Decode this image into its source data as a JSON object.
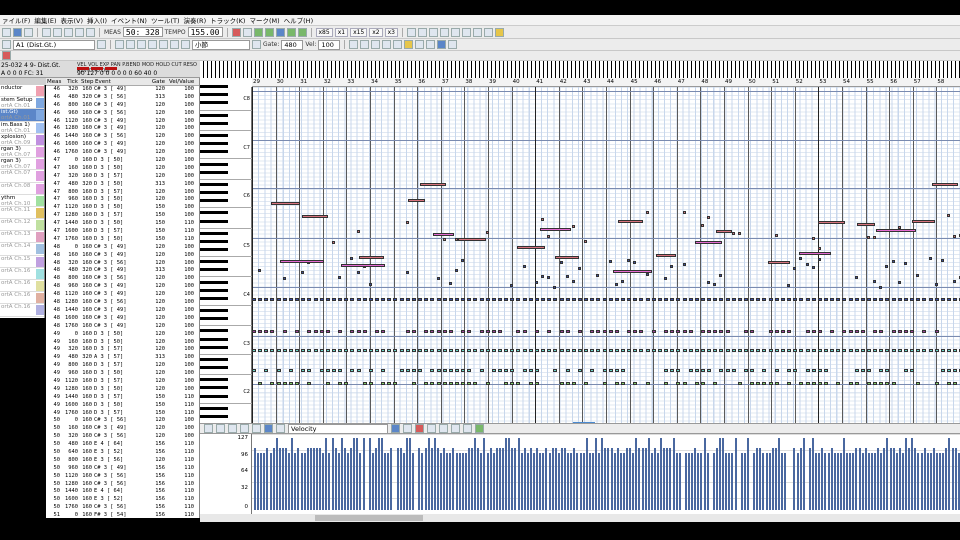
{
  "menu": [
    "ァイル(F)",
    "編集(E)",
    "表示(V)",
    "挿入(I)",
    "イベント(N)",
    "ツール(T)",
    "演奏(R)",
    "トラック(K)",
    "マーク(M)",
    "ヘルプ(H)"
  ],
  "transport": {
    "meas_label": "MEAS",
    "position": "50: 328",
    "tempo_label": "TEMPO",
    "tempo": "155.00",
    "speeds": [
      "x85",
      "x1",
      "x15",
      "x2",
      "x3"
    ]
  },
  "toolbar2": {
    "track_select": "A1 (Dist.Gt.)",
    "measure_select": "小節",
    "gate_label": "Gate:",
    "gate_value": "480",
    "vel_label": "Vel:",
    "vel_value": "100"
  },
  "trackinfo": {
    "line1": "25-032 4 9- Dist.Gt.",
    "line2": "A 0 0 0 FC: 31",
    "meter_labels": "VEL VOL EXP PAN P.BEND MOD HOLD CUT RESO REV CHO DLY",
    "meter_values": "90 127 0 0 0 0 0 0 60 40 0"
  },
  "tracks": [
    {
      "name": "nductor",
      "port": ""
    },
    {
      "name": "stem Setup",
      "port": "ortA Ch.01"
    },
    {
      "name": "ist.Gt)",
      "port": "ortA Ch.01"
    },
    {
      "name": "im.Bass 1)",
      "port": "ortA Ch.01"
    },
    {
      "name": "xplosion)",
      "port": "ortA Ch.09"
    },
    {
      "name": "rgan 3)",
      "port": "ortA Ch.07"
    },
    {
      "name": "rgan 3)",
      "port": "ortA Ch.07"
    },
    {
      "name": "",
      "port": "ortA Ch.07"
    },
    {
      "name": "",
      "port": "ortA Ch.08"
    },
    {
      "name": "ythm",
      "port": "ortA Ch.10"
    },
    {
      "name": "",
      "port": "ortA Ch.11"
    },
    {
      "name": "",
      "port": "ortA Ch.12"
    },
    {
      "name": "",
      "port": "ortA Ch.13"
    },
    {
      "name": "",
      "port": "ortA Ch.14"
    },
    {
      "name": "",
      "port": "ortA Ch.15"
    },
    {
      "name": "",
      "port": "ortA Ch.16"
    },
    {
      "name": "",
      "port": "ortA Ch.16"
    },
    {
      "name": "",
      "port": "ortA Ch.16"
    },
    {
      "name": "",
      "port": "ortA Ch.16"
    }
  ],
  "event_headers": [
    "Meas",
    "Tick",
    "Step",
    "Event",
    "Gate",
    "Vel/Value"
  ],
  "events": [
    [
      "46",
      "320",
      "160",
      "C# 3 [ 49]",
      "120",
      "100"
    ],
    [
      "46",
      "480",
      "320",
      "C# 3 [ 56]",
      "313",
      "100"
    ],
    [
      "46",
      "800",
      "160",
      "C# 3 [ 49]",
      "120",
      "100"
    ],
    [
      "46",
      "960",
      "160",
      "C# 3 [ 56]",
      "120",
      "100"
    ],
    [
      "46",
      "1120",
      "160",
      "C# 3 [ 49]",
      "120",
      "100"
    ],
    [
      "46",
      "1280",
      "160",
      "C# 3 [ 49]",
      "120",
      "100"
    ],
    [
      "46",
      "1440",
      "160",
      "C# 3 [ 56]",
      "120",
      "100"
    ],
    [
      "46",
      "1600",
      "160",
      "C# 3 [ 49]",
      "120",
      "100"
    ],
    [
      "46",
      "1760",
      "160",
      "C# 3 [ 49]",
      "120",
      "100"
    ],
    [
      "47",
      "0",
      "160",
      "D  3 [ 50]",
      "120",
      "100"
    ],
    [
      "47",
      "160",
      "160",
      "D  3 [ 50]",
      "120",
      "100"
    ],
    [
      "47",
      "320",
      "160",
      "D  3 [ 57]",
      "120",
      "100"
    ],
    [
      "47",
      "480",
      "320",
      "D  3 [ 50]",
      "313",
      "100"
    ],
    [
      "47",
      "800",
      "160",
      "D  3 [ 57]",
      "120",
      "100"
    ],
    [
      "47",
      "960",
      "160",
      "D  3 [ 50]",
      "120",
      "100"
    ],
    [
      "47",
      "1120",
      "160",
      "D  3 [ 50]",
      "150",
      "100"
    ],
    [
      "47",
      "1280",
      "160",
      "D  3 [ 57]",
      "150",
      "100"
    ],
    [
      "47",
      "1440",
      "160",
      "D  3 [ 50]",
      "150",
      "110"
    ],
    [
      "47",
      "1600",
      "160",
      "D  3 [ 57]",
      "150",
      "110"
    ],
    [
      "47",
      "1760",
      "160",
      "D  3 [ 50]",
      "150",
      "110"
    ],
    [
      "48",
      "0",
      "160",
      "C# 3 [ 49]",
      "120",
      "100"
    ],
    [
      "48",
      "160",
      "160",
      "C# 3 [ 49]",
      "120",
      "100"
    ],
    [
      "48",
      "320",
      "160",
      "C# 3 [ 56]",
      "120",
      "100"
    ],
    [
      "48",
      "480",
      "320",
      "C# 3 [ 49]",
      "313",
      "100"
    ],
    [
      "48",
      "800",
      "160",
      "C# 3 [ 56]",
      "120",
      "100"
    ],
    [
      "48",
      "960",
      "160",
      "C# 3 [ 49]",
      "120",
      "100"
    ],
    [
      "48",
      "1120",
      "160",
      "C# 3 [ 49]",
      "120",
      "100"
    ],
    [
      "48",
      "1280",
      "160",
      "C# 3 [ 56]",
      "120",
      "100"
    ],
    [
      "48",
      "1440",
      "160",
      "C# 3 [ 49]",
      "120",
      "100"
    ],
    [
      "48",
      "1600",
      "160",
      "C# 3 [ 49]",
      "120",
      "100"
    ],
    [
      "48",
      "1760",
      "160",
      "C# 3 [ 49]",
      "120",
      "100"
    ],
    [
      "49",
      "0",
      "160",
      "D  3 [ 50]",
      "120",
      "100"
    ],
    [
      "49",
      "160",
      "160",
      "D  3 [ 50]",
      "120",
      "100"
    ],
    [
      "49",
      "320",
      "160",
      "D  3 [ 57]",
      "120",
      "100"
    ],
    [
      "49",
      "480",
      "320",
      "A  3 [ 57]",
      "313",
      "100"
    ],
    [
      "49",
      "800",
      "160",
      "D  3 [ 57]",
      "120",
      "100"
    ],
    [
      "49",
      "960",
      "160",
      "D  3 [ 50]",
      "120",
      "100"
    ],
    [
      "49",
      "1120",
      "160",
      "D  3 [ 57]",
      "120",
      "100"
    ],
    [
      "49",
      "1280",
      "160",
      "D  3 [ 50]",
      "120",
      "100"
    ],
    [
      "49",
      "1440",
      "160",
      "D  3 [ 57]",
      "150",
      "110"
    ],
    [
      "49",
      "1600",
      "160",
      "D  3 [ 50]",
      "150",
      "110"
    ],
    [
      "49",
      "1760",
      "160",
      "D  3 [ 57]",
      "150",
      "110"
    ],
    [
      "50",
      "0",
      "160",
      "C# 3 [ 56]",
      "120",
      "100"
    ],
    [
      "50",
      "160",
      "160",
      "C# 3 [ 49]",
      "120",
      "100"
    ],
    [
      "50",
      "320",
      "160",
      "C# 3 [ 56]",
      "120",
      "100"
    ],
    [
      "50",
      "480",
      "160",
      "E  4 [ 64]",
      "156",
      "110"
    ],
    [
      "50",
      "640",
      "160",
      "E  3 [ 52]",
      "156",
      "110"
    ],
    [
      "50",
      "800",
      "160",
      "E  3 [ 56]",
      "120",
      "110"
    ],
    [
      "50",
      "960",
      "160",
      "C# 3 [ 49]",
      "156",
      "110"
    ],
    [
      "50",
      "1120",
      "160",
      "C# 3 [ 56]",
      "156",
      "110"
    ],
    [
      "50",
      "1280",
      "160",
      "C# 3 [ 56]",
      "156",
      "110"
    ],
    [
      "50",
      "1440",
      "160",
      "E  4 [ 64]",
      "156",
      "110"
    ],
    [
      "50",
      "1600",
      "160",
      "E  3 [ 52]",
      "156",
      "110"
    ],
    [
      "50",
      "1760",
      "160",
      "C# 3 [ 56]",
      "156",
      "110"
    ],
    [
      "51",
      "0",
      "160",
      "F# 3 [ 54]",
      "156",
      "110"
    ],
    [
      "51",
      "160",
      "160",
      "C# 3 [ 49]",
      "120",
      "110"
    ],
    [
      "51",
      "320",
      "160",
      "C# 3 [ 56]",
      "120",
      "110"
    ],
    [
      "51",
      "480",
      "160",
      "C# 3 [ 49]",
      "120",
      "110"
    ]
  ],
  "ruler": [
    "29",
    "30",
    "31",
    "32",
    "33",
    "34",
    "35",
    "36",
    "37",
    "38",
    "39",
    "40",
    "41",
    "42",
    "43",
    "44",
    "45",
    "46",
    "47",
    "48",
    "49",
    "50",
    "51",
    "52",
    "53",
    "54",
    "55",
    "56",
    "57",
    "58"
  ],
  "octaves": [
    "C8",
    "C7",
    "C6",
    "C5",
    "C4",
    "C3",
    "C2"
  ],
  "velocity_panel": {
    "selector": "Velocity",
    "scale": [
      "127",
      "96",
      "64",
      "32",
      "0"
    ]
  },
  "colors": {
    "note_red": "#d8737e",
    "note_pink": "#e46ad2",
    "note_blue": "#3a4fa8",
    "note_teal": "#6ed6c8",
    "note_green": "#7fd16a",
    "note_purple": "#a0409a",
    "selected_track": "#5b86c8",
    "velocity_bar": "#4a68a0"
  }
}
